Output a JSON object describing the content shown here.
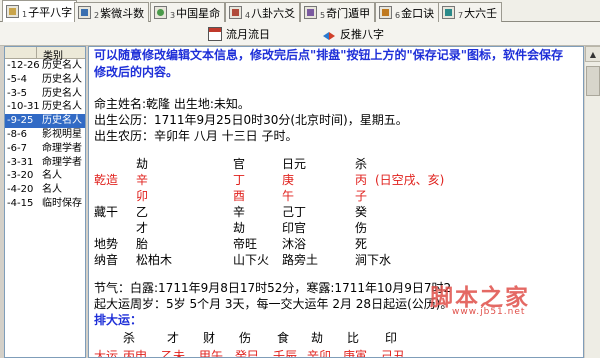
{
  "tabs": [
    {
      "num": "1",
      "label": "子平八字",
      "icon": "bazi-icon",
      "active": true
    },
    {
      "num": "2",
      "label": "紫微斗数",
      "icon": "ziwei-icon"
    },
    {
      "num": "3",
      "label": "中国星命",
      "icon": "xingming-icon"
    },
    {
      "num": "4",
      "label": "八卦六爻",
      "icon": "bagua-icon"
    },
    {
      "num": "5",
      "label": "奇门遁甲",
      "icon": "qimen-icon"
    },
    {
      "num": "6",
      "label": "金口诀",
      "icon": "jinkou-icon"
    },
    {
      "num": "7",
      "label": "大六壬",
      "icon": "liuren-icon"
    }
  ],
  "toolbar": {
    "liuyue": "流月流日",
    "fantui": "反推八字"
  },
  "list": {
    "header": "类别",
    "rows": [
      {
        "date": "-12-26",
        "cat": "历史名人"
      },
      {
        "date": "-5-4",
        "cat": "历史名人"
      },
      {
        "date": "-3-5",
        "cat": "历史名人"
      },
      {
        "date": "-10-31",
        "cat": "历史名人"
      },
      {
        "date": "-9-25",
        "cat": "历史名人",
        "selected": true
      },
      {
        "date": "-8-6",
        "cat": "影视明星"
      },
      {
        "date": "-6-7",
        "cat": "命理学者"
      },
      {
        "date": "-3-31",
        "cat": "命理学者"
      },
      {
        "date": "-3-20",
        "cat": "名人"
      },
      {
        "date": "-4-20",
        "cat": "名人"
      },
      {
        "date": "-4-15",
        "cat": "临时保存"
      }
    ]
  },
  "content": {
    "notice": "可以随意修改编辑文本信息，修改完后点\"排盘\"按钮上方的\"保存记录\"图标，软件会保存修改后的内容。",
    "name_line": "命主姓名:乾隆   出生地:未知。",
    "gongli_line": "出生公历：1711年9月25日0时30分(北京时间)，星期五。",
    "nongli_line": "出生农历：辛卯年 八月 十三日 子时。",
    "shishen_top": [
      "劫",
      "官",
      "日元",
      "杀"
    ],
    "qianzao_label": "乾造",
    "tiangan": [
      "辛",
      "丁",
      "庚",
      "丙"
    ],
    "kongwang": "(日空戌、亥)",
    "dizhi": [
      "卯",
      "酉",
      "午",
      "子"
    ],
    "canggan_label": "藏干",
    "canggan": [
      "乙",
      "辛",
      "己丁",
      "癸"
    ],
    "canggan_shen": [
      "才",
      "劫",
      "印官",
      "伤"
    ],
    "dishi_label": "地势",
    "dishi": [
      "胎",
      "帝旺",
      "沐浴",
      "死"
    ],
    "nayin_label": "纳音",
    "nayin": [
      "松柏木",
      "山下火",
      "路旁土",
      "涧下水"
    ],
    "jieqi_line": "节气：白露:1711年9月8日17时52分，寒露:1711年10月9日7时2",
    "qiyun_line": "起大运周岁：5岁 5个月 3天，每一交大运年 2月 28日起运(公历)。",
    "dayun_title": "排大运：",
    "dayun_shen": [
      "杀",
      "才",
      "财",
      "伤",
      "食",
      "劫",
      "比",
      "印"
    ],
    "dayun_label": "大运",
    "dayun_gz": [
      "丙申",
      "乙未",
      "甲午",
      "癸巳",
      "壬辰",
      "辛卯",
      "庚寅",
      "己丑"
    ]
  },
  "watermark": {
    "text": "脚本之家",
    "url": "www.jb51.net"
  },
  "colors": {
    "red": "#e0211d",
    "blue": "#1e2fd8",
    "selection": "#316ac5"
  }
}
